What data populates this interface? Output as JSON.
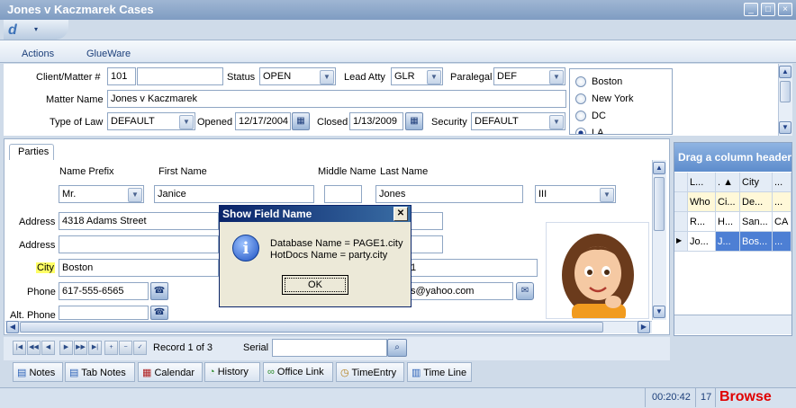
{
  "window": {
    "title": "Jones v Kaczmarek Cases"
  },
  "menu": {
    "items": [
      "Actions",
      "GlueWare"
    ]
  },
  "form": {
    "client_matter_label": "Client/Matter #",
    "client_matter_value": "101",
    "client_matter_extra": "",
    "status_label": "Status",
    "status_value": "OPEN",
    "lead_atty_label": "Lead Atty",
    "lead_atty_value": "GLR",
    "paralegal_label": "Paralegal",
    "paralegal_value": "DEF",
    "matter_name_label": "Matter Name",
    "matter_name_value": "Jones v Kaczmarek",
    "type_of_law_label": "Type of Law",
    "type_of_law_value": "DEFAULT",
    "opened_label": "Opened",
    "opened_value": "12/17/2004",
    "closed_label": "Closed",
    "closed_value": "1/13/2009",
    "security_label": "Security",
    "security_value": "DEFAULT"
  },
  "locations": [
    "Boston",
    "New York",
    "DC",
    "LA"
  ],
  "locations_selected": "LA",
  "parties": {
    "tab_label": "Parties",
    "name_prefix_label": "Name Prefix",
    "first_name_label": "First Name",
    "middle_name_label": "Middle Name",
    "last_name_label": "Last Name",
    "name_prefix": "Mr.",
    "first_name": "Janice",
    "middle_name": "",
    "last_name": "Jones",
    "suffix": "III",
    "address_label": "Address",
    "address1": "4318 Adams Street",
    "address2_label": "Address",
    "address2": "",
    "city_label": "City",
    "city": "Boston",
    "phone_label": "Phone",
    "phone": "617-555-6565",
    "alt_phone_label": "Alt. Phone",
    "alt_phone": "",
    "email_partial": "s@yahoo.com",
    "partial_zip": "1"
  },
  "grid": {
    "group_header": "Drag a column header",
    "columns": [
      "L...",
      ". ▲",
      "City",
      "..."
    ],
    "rows": [
      [
        "Who",
        "Ci...",
        "De...",
        "..."
      ],
      [
        "R...",
        "H...",
        "San...",
        "CA"
      ],
      [
        "Jo...",
        "J...",
        "Bos...",
        "..."
      ]
    ]
  },
  "navigator": {
    "record_text": "Record 1 of 3",
    "serial_label": "Serial",
    "serial_value": ""
  },
  "buttons": [
    "Notes",
    "Tab Notes",
    "Calendar",
    "History",
    "Office Link",
    "TimeEntry",
    "Time Line"
  ],
  "status": {
    "time": "00:20:42",
    "count": "17",
    "mode": "Browse"
  },
  "dialog": {
    "title": "Show Field Name",
    "line1": "Database Name = PAGE1.city",
    "line2": "HotDocs Name = party.city",
    "ok": "OK"
  },
  "colors": {
    "city_highlight": "#ffff66",
    "browse": "#e00000",
    "selection": "#4d7fd4"
  }
}
